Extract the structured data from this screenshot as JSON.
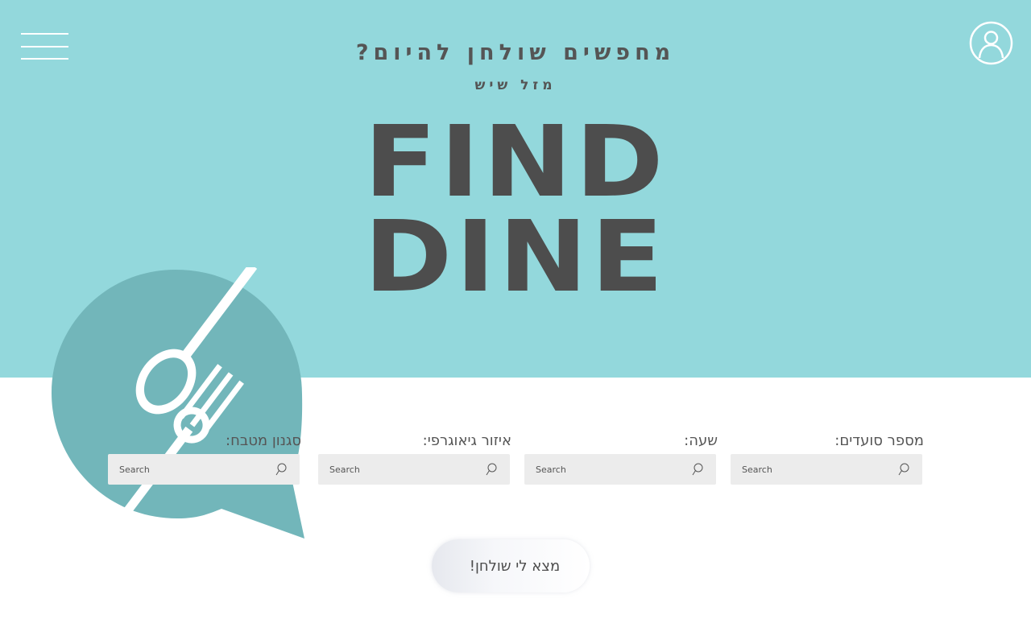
{
  "header": {
    "tagline": "מחפשים שולחן להיום?",
    "subtag": "מזל שיש",
    "brand_line1": "FIND",
    "brand_line2": "DINE",
    "menu_icon": "hamburger-menu-icon",
    "user_icon": "user-profile-icon"
  },
  "filters": [
    {
      "label": "סגנון מטבח:",
      "placeholder": "Search"
    },
    {
      "label": "איזור גיאוגרפי:",
      "placeholder": "Search"
    },
    {
      "label": "שעה:",
      "placeholder": "Search"
    },
    {
      "label": "מספר סועדים:",
      "placeholder": "Search"
    }
  ],
  "cta": {
    "label": "מצא לי שולחן!"
  },
  "colors": {
    "hero_background": "#93d8dc",
    "logo_bubble": "#72b6ba",
    "text_dark": "#4d4d4d",
    "input_background": "#ececec"
  }
}
